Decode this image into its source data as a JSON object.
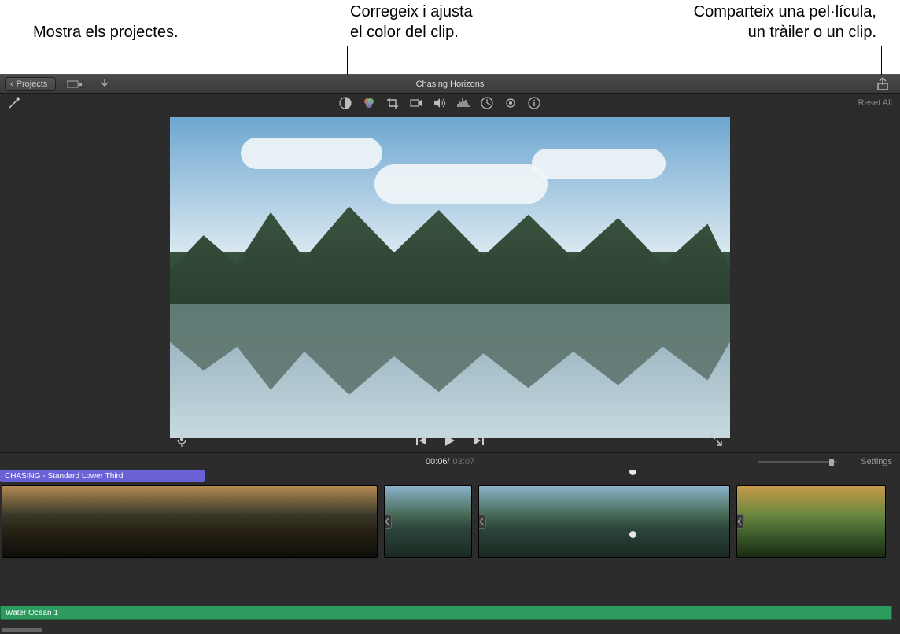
{
  "callouts": {
    "projects": "Mostra els projectes.",
    "color": "Corregeix i ajusta\nel color del clip.",
    "share": "Comparteix una pel·lícula,\nun tràiler o un clip."
  },
  "toolbar": {
    "projects_label": "Projects",
    "project_title": "Chasing Horizons"
  },
  "adjust": {
    "reset_label": "Reset All"
  },
  "timecode": {
    "current": "00:06",
    "separator": " / ",
    "total": "03:07",
    "settings_label": "Settings"
  },
  "timeline": {
    "title_strip": "CHASING - Standard Lower Third",
    "audio_strip": "Water Ocean 1"
  },
  "icons": {
    "chevron_left": "‹",
    "import": "⬇",
    "share": "⇪",
    "wand": "✦",
    "color_balance": "◐",
    "color_palette": "🎨",
    "crop": "⧉",
    "camera": "📹",
    "volume": "🔊",
    "equalizer": "≡",
    "speed": "◔",
    "filter": "◯",
    "info": "ⓘ",
    "mic": "🎙",
    "prev": "▮◀",
    "play": "▶",
    "next": "▶▮",
    "fullscreen": "⤢",
    "transition": "▶◀"
  }
}
